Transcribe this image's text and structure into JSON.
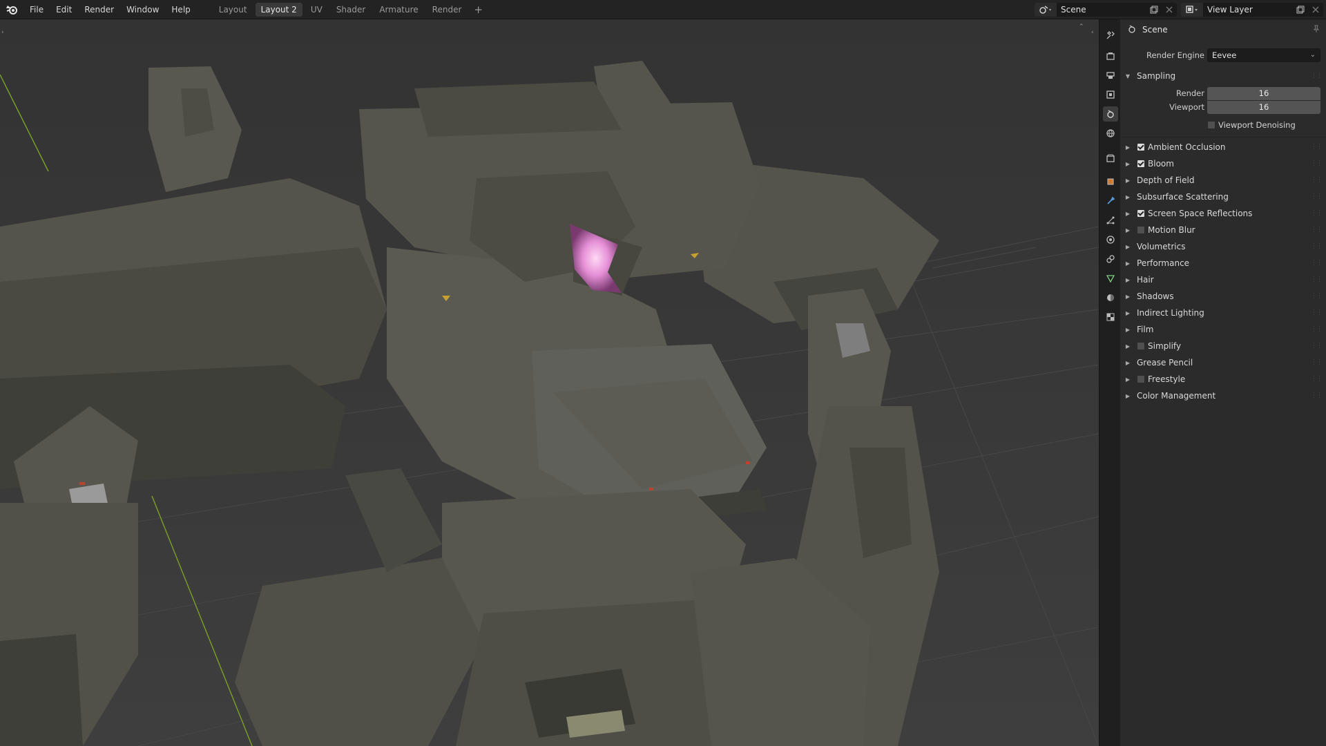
{
  "topbar": {
    "menus": [
      "File",
      "Edit",
      "Render",
      "Window",
      "Help"
    ],
    "workspace_tabs": [
      "Layout",
      "Layout 2",
      "UV",
      "Shader",
      "Armature",
      "Render"
    ],
    "active_tab": "Layout 2",
    "add_tab_symbol": "+",
    "scene_name": "Scene",
    "view_layer_name": "View Layer"
  },
  "properties": {
    "header_title": "Scene",
    "render_engine_label": "Render Engine",
    "render_engine_value": "Eevee",
    "sampling": {
      "label": "Sampling",
      "render_label": "Render",
      "render_value": "16",
      "viewport_label": "Viewport",
      "viewport_value": "16",
      "viewport_denoising_label": "Viewport Denoising",
      "viewport_denoising_checked": false
    },
    "panels": [
      {
        "label": "Ambient Occlusion",
        "has_checkbox": true,
        "checked": true
      },
      {
        "label": "Bloom",
        "has_checkbox": true,
        "checked": true
      },
      {
        "label": "Depth of Field",
        "has_checkbox": false,
        "checked": false
      },
      {
        "label": "Subsurface Scattering",
        "has_checkbox": false,
        "checked": false
      },
      {
        "label": "Screen Space Reflections",
        "has_checkbox": true,
        "checked": true
      },
      {
        "label": "Motion Blur",
        "has_checkbox": true,
        "checked": false
      },
      {
        "label": "Volumetrics",
        "has_checkbox": false,
        "checked": false
      },
      {
        "label": "Performance",
        "has_checkbox": false,
        "checked": false
      },
      {
        "label": "Hair",
        "has_checkbox": false,
        "checked": false
      },
      {
        "label": "Shadows",
        "has_checkbox": false,
        "checked": false
      },
      {
        "label": "Indirect Lighting",
        "has_checkbox": false,
        "checked": false
      },
      {
        "label": "Film",
        "has_checkbox": false,
        "checked": false
      },
      {
        "label": "Simplify",
        "has_checkbox": true,
        "checked": false
      },
      {
        "label": "Grease Pencil",
        "has_checkbox": false,
        "checked": false
      },
      {
        "label": "Freestyle",
        "has_checkbox": true,
        "checked": false
      },
      {
        "label": "Color Management",
        "has_checkbox": false,
        "checked": false
      }
    ]
  },
  "property_tabs": [
    "tool-icon",
    "render-icon",
    "output-icon",
    "view-layer-icon",
    "scene-icon",
    "world-icon",
    "collection-icon",
    "object-icon",
    "modifier-icon",
    "particles-icon",
    "physics-icon",
    "constraints-icon",
    "data-icon",
    "material-icon",
    "texture-icon"
  ],
  "colors": {
    "viewport_bg": "#3a3a3a",
    "panel_bg": "#2b2b2b",
    "model_gray": "#4f4f48",
    "visor_glow": "#e58fd6",
    "y_axis": "#7a9a2a"
  }
}
